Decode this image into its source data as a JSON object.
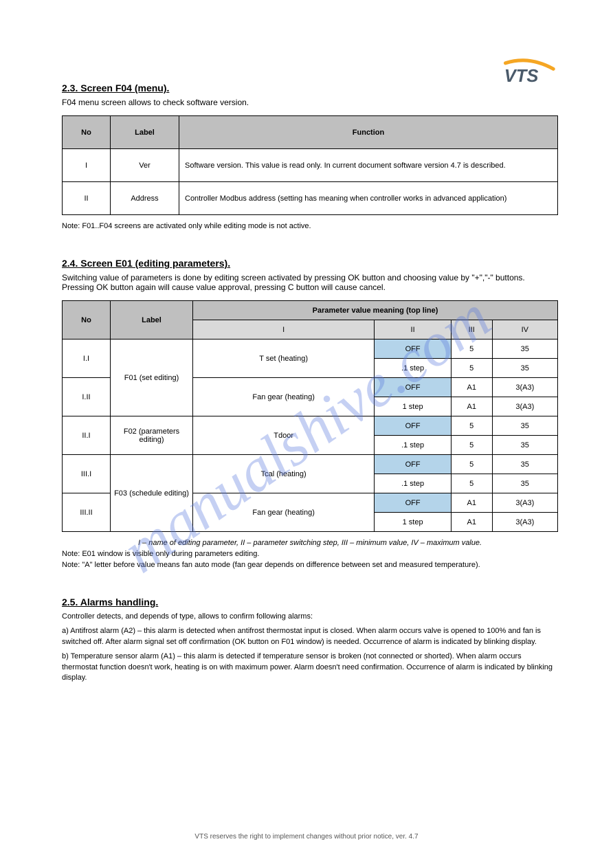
{
  "logo_text": "VTS",
  "watermark": "manualshive.com",
  "sec23": {
    "heading": "2.3. Screen F04 (menu).",
    "desc": "F04 menu screen allows to check software version.",
    "table": {
      "headers": [
        "No",
        "Label",
        "Function"
      ],
      "rows": [
        {
          "no": "I",
          "label": "Ver",
          "func": "Software version. This value is read only. In current document software version 4.7 is described."
        },
        {
          "no": "II",
          "label": "Address",
          "func": "Controller Modbus address (setting has meaning when controller works in advanced application)"
        }
      ]
    },
    "note": "Note: F01..F04 screens are activated only while editing mode is not active."
  },
  "sec24": {
    "heading": "2.4. Screen E01 (editing parameters).",
    "desc": "Switching value of parameters is done by editing screen activated by pressing OK button and choosing value by \"+\",\"-\" buttons. Pressing OK button again will cause value approval, pressing C button will cause cancel.",
    "table": {
      "group_header": "Parameter value meaning (top line)",
      "headers": [
        "No",
        "Label",
        "I",
        "II",
        "III",
        "IV"
      ],
      "rows": [
        {
          "no": "I.I",
          "label_rowspan": 4,
          "label": "F01 (set editing)",
          "i": "T set (heating)",
          "ii": "OFF",
          "iii": "5",
          "iv": "35",
          "ii_blue": true
        },
        {
          "no": "I.I",
          "i": "T set (heating)",
          "ii": ".1 step",
          "iii": "5",
          "iv": "35"
        },
        {
          "no": "I.II",
          "i": "Fan gear (heating)",
          "ii": "OFF",
          "iii": "A1",
          "iv": "3(A3)",
          "ii_blue": true
        },
        {
          "no": "I.II",
          "i": "Fan gear (heating)",
          "ii": "1 step",
          "iii": "A1",
          "iv": "3(A3)"
        },
        {
          "no": "II.I",
          "label_rowspan": 2,
          "label": "F02 (parameters editing)",
          "i": "Tdoor",
          "ii": "OFF",
          "iii": "5",
          "iv": "35",
          "ii_blue": true
        },
        {
          "no": "II.I",
          "i": "Tdoor",
          "ii": ".1 step",
          "iii": "5",
          "iv": "35"
        },
        {
          "no": "III.I",
          "label_rowspan": 4,
          "label": "F03 (schedule editing)",
          "i": "Tcal (heating)",
          "ii": "OFF",
          "iii": "5",
          "iv": "35",
          "ii_blue": true
        },
        {
          "no": "III.I",
          "i": "Tcal (heating)",
          "ii": ".1 step",
          "iii": "5",
          "iv": "35"
        },
        {
          "no": "III.II",
          "i": "Fan gear (heating)",
          "ii": "OFF",
          "iii": "A1",
          "iv": "3(A3)",
          "ii_blue": true
        },
        {
          "no": "III.II",
          "i": "Fan gear (heating)",
          "ii": "1 step",
          "iii": "A1",
          "iv": "3(A3)"
        }
      ]
    },
    "notes": [
      "I – name of editing parameter, II – parameter switching step, III – minimum value, IV – maximum value.",
      "Note: E01 window is visible only during parameters editing.",
      "Note: \"A\" letter before value means fan auto mode (fan gear depends on difference between set and measured temperature)."
    ]
  },
  "sec25": {
    "heading": "2.5. Alarms handling.",
    "paras": [
      "Controller detects, and depends of type, allows to confirm following alarms:",
      "a) Antifrost alarm (A2) – this alarm is detected when antifrost thermostat input is closed. When alarm occurs valve is opened to 100% and fan is switched off. After alarm signal set off confirmation (OK button on F01 window) is needed. Occurrence of alarm is indicated by blinking display.",
      "b) Temperature sensor alarm (A1) – this alarm is detected if temperature sensor is broken (not connected or shorted). When alarm occurs thermostat function doesn't work, heating is on with maximum power. Alarm doesn't need confirmation. Occurrence of alarm is indicated by blinking display."
    ]
  },
  "copyright": "VTS reserves the right to implement changes without prior notice, ver. 4.7"
}
